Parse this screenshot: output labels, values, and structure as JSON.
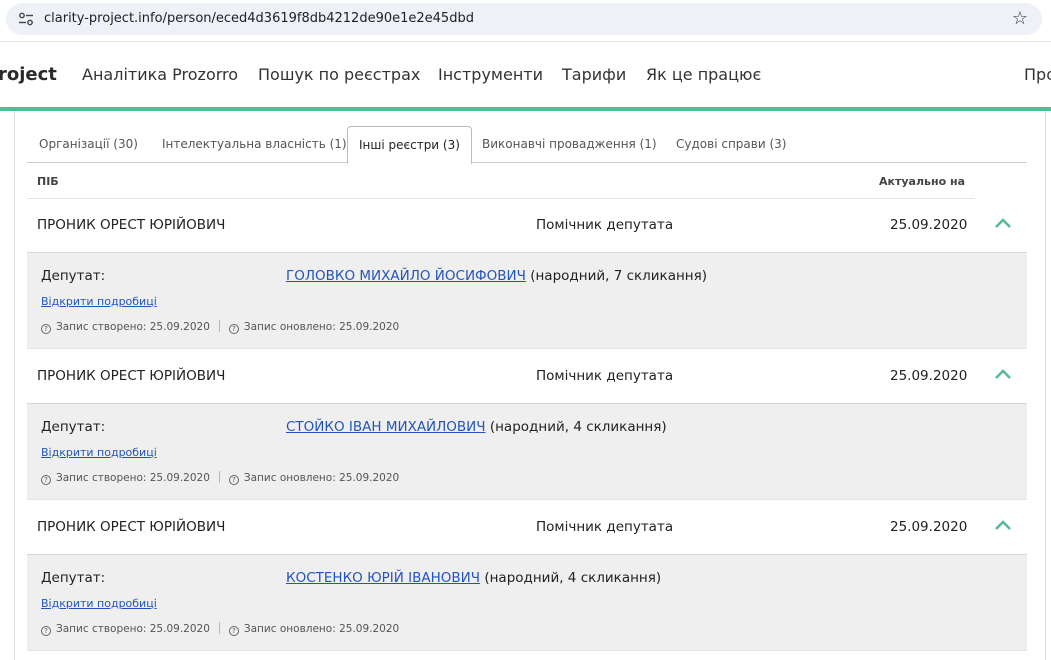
{
  "browser": {
    "url": "clarity-project.info/person/eced4d3619f8db4212de90e1e2e45dbd"
  },
  "nav": {
    "brand": "roject",
    "items": [
      "Аналітика Prozorro",
      "Пошук по реєстрах",
      "Інструменти",
      "Тарифи",
      "Як це працює"
    ],
    "right_cut": "Про"
  },
  "tabs": [
    {
      "label": "Організації (30)"
    },
    {
      "label": "Інтелектуальна власність (1)"
    },
    {
      "label": "Інші реєстри (3)",
      "active": true
    },
    {
      "label": "Виконавчі провадження (1)"
    },
    {
      "label": "Судові справи (3)"
    }
  ],
  "table": {
    "col_name": "ПІБ",
    "col_date": "Актуально на"
  },
  "records": [
    {
      "name": "ПРОНИК ОРЕСТ ЮРІЙОВИЧ",
      "role": "Помічник депутата",
      "date": "25.09.2020",
      "detail_label": "Депутат:",
      "deputy": "ГОЛОВКО МИХАЙЛО ЙОСИФОВИЧ",
      "deputy_note": " (народний, 7 скликання)",
      "more": "Відкрити подробиці",
      "created": "Запис створено: 25.09.2020",
      "updated": "Запис оновлено: 25.09.2020"
    },
    {
      "name": "ПРОНИК ОРЕСТ ЮРІЙОВИЧ",
      "role": "Помічник депутата",
      "date": "25.09.2020",
      "detail_label": "Депутат:",
      "deputy": "СТОЙКО ІВАН МИХАЙЛОВИЧ",
      "deputy_note": " (народний, 4 скликання)",
      "more": "Відкрити подробиці",
      "created": "Запис створено: 25.09.2020",
      "updated": "Запис оновлено: 25.09.2020"
    },
    {
      "name": "ПРОНИК ОРЕСТ ЮРІЙОВИЧ",
      "role": "Помічник депутата",
      "date": "25.09.2020",
      "detail_label": "Депутат:",
      "deputy": "КОСТЕНКО ЮРІЙ ІВАНОВИЧ",
      "deputy_note": " (народний, 4 скликання)",
      "more": "Відкрити подробиці",
      "created": "Запис створено: 25.09.2020",
      "updated": "Запис оновлено: 25.09.2020"
    }
  ],
  "colors": {
    "accent": "#5cb996",
    "link": "#2255bb"
  }
}
